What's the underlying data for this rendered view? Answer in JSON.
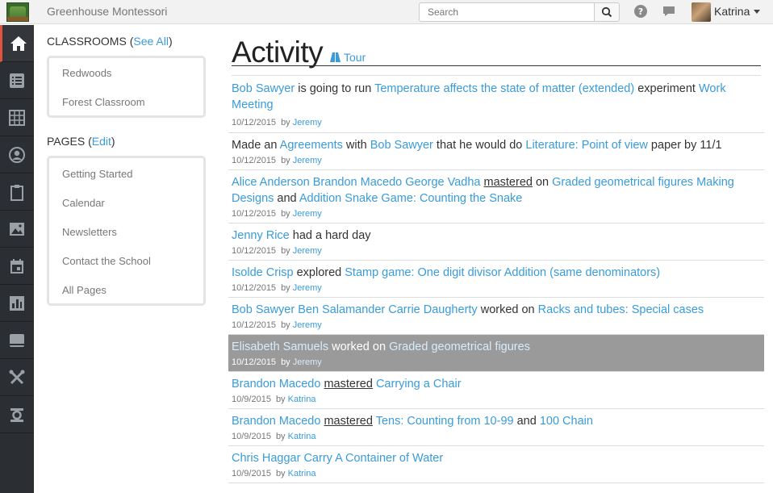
{
  "header": {
    "school_name": "Greenhouse Montessori",
    "search_placeholder": "Search",
    "user_name": "Katrina"
  },
  "nav_icons": [
    "home-icon",
    "list-icon",
    "grid-icon",
    "user-circle-icon",
    "clipboard-icon",
    "image-icon",
    "calendar-icon",
    "bar-chart-icon",
    "panel-icon",
    "tools-icon",
    "settings-icon"
  ],
  "sidebar": {
    "classrooms_title": "CLASSROOMS (",
    "see_all": "See All",
    "close_paren": ")",
    "classrooms": [
      "Redwoods",
      "Forest Classroom"
    ],
    "pages_title": "PAGES (",
    "edit": "Edit",
    "pages": [
      "Getting Started",
      "Calendar",
      "Newsletters",
      "Contact the School",
      "All Pages"
    ]
  },
  "main": {
    "title": "Activity",
    "tour": "Tour"
  },
  "feed": [
    {
      "date": "10/12/2015",
      "by": "by",
      "author": "Jeremy"
    },
    {
      "date": "10/12/2015",
      "by": "by",
      "author": "Jeremy"
    },
    {
      "date": "10/12/2015",
      "by": "by",
      "author": "Jeremy"
    },
    {
      "date": "10/12/2015",
      "by": "by",
      "author": "Jeremy"
    },
    {
      "date": "10/12/2015",
      "by": "by",
      "author": "Jeremy"
    },
    {
      "date": "10/12/2015",
      "by": "by",
      "author": "Jeremy"
    },
    {
      "date": "10/12/2015",
      "by": "by",
      "author": "Jeremy"
    },
    {
      "date": "10/9/2015",
      "by": "by",
      "author": "Katrina"
    },
    {
      "date": "10/9/2015",
      "by": "by",
      "author": "Katrina"
    },
    {
      "date": "10/9/2015",
      "by": "by",
      "author": "Katrina"
    }
  ],
  "feed_text": {
    "r0": {
      "a": "Bob Sawyer",
      "b": " is going to run ",
      "c": "Temperature affects the state of matter (extended)",
      "d": " experiment ",
      "e": "Work Meeting"
    },
    "r1": {
      "a": "Made an ",
      "b": "Agreements",
      "c": " with ",
      "d": "Bob Sawyer",
      "e": " that he would do ",
      "f": "Literature: Point of view",
      "g": " paper by 11/1"
    },
    "r2": {
      "a": "Alice Anderson",
      "b": " ",
      "c": "Brandon Macedo",
      "d": " ",
      "e": "George Vadha",
      "f": " ",
      "g": "mastered",
      "h": " on ",
      "i": "Graded geometrical figures",
      "j": " ",
      "k": "Making Designs",
      "l": " and ",
      "m": "Addition Snake Game: Counting the Snake"
    },
    "r3": {
      "a": "Jenny Rice",
      "b": " had a hard day"
    },
    "r4": {
      "a": "Isolde Crisp",
      "b": " explored ",
      "c": "Stamp game: One digit divisor Addition (same denominators)"
    },
    "r5": {
      "a": "Bob Sawyer",
      "b": " ",
      "c": "Ben Salamander",
      "d": " ",
      "e": "Carrie Daugherty",
      "f": " worked on ",
      "g": "Racks and tubes: Special cases"
    },
    "r6": {
      "a": "Elisabeth Samuels",
      "b": " worked on ",
      "c": "Graded geometrical figures"
    },
    "r7": {
      "a": "Brandon Macedo",
      "b": " ",
      "c": "mastered",
      "d": " ",
      "e": "Carrying a Chair"
    },
    "r8": {
      "a": "Brandon Macedo",
      "b": " ",
      "c": "mastered",
      "d": " ",
      "e": "Tens: Counting from 10-99",
      "f": " and ",
      "g": "100 Chain"
    },
    "r9": {
      "a": "Chris Haggar",
      "b": " ",
      "c": "Carry A Container of Water"
    }
  },
  "colors": {
    "link": "#3a9bd9",
    "nav_bg": "#2b2e33",
    "nav_active": "#e0533f",
    "highlight_row": "#9a9a9a"
  }
}
